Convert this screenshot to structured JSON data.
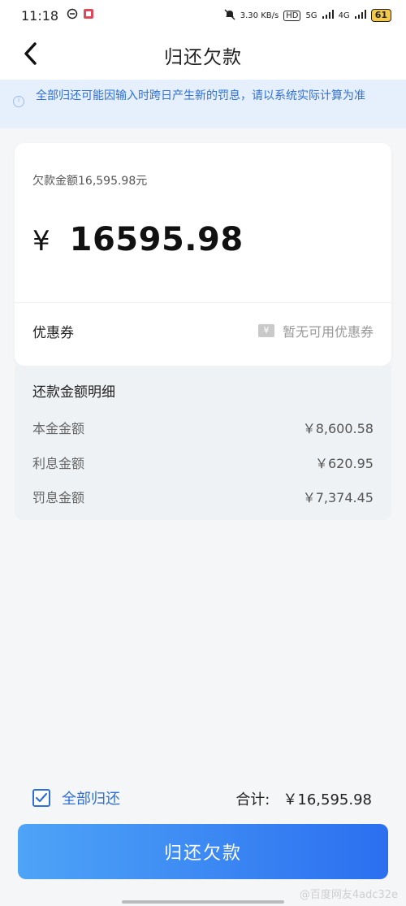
{
  "status_bar": {
    "time": "11:18",
    "net_speed": "3.30 KB/s",
    "hd": "HD",
    "signal_5g": "5G",
    "signal_4g": "4G",
    "battery": "61"
  },
  "header": {
    "title": "归还欠款"
  },
  "notice": {
    "text": "全部归还可能因输入时跨日产生新的罚息，请以系统实际计算为准"
  },
  "card": {
    "debt_label": "欠款金额16,595.98元",
    "currency_symbol": "¥",
    "amount": "16595.98",
    "coupon_label": "优惠券",
    "coupon_value": "暂无可用优惠券"
  },
  "detail": {
    "title": "还款金额明细",
    "rows": [
      {
        "label": "本金金额",
        "value": "￥8,600.58"
      },
      {
        "label": "利息金额",
        "value": "￥620.95"
      },
      {
        "label": "罚息金额",
        "value": "￥7,374.45"
      }
    ]
  },
  "footer": {
    "check_label": "全部归还",
    "total_label": "合计:",
    "total_value": "￥16,595.98",
    "button_label": "归还欠款"
  },
  "watermark": "@百度网友4adc32e",
  "colors": {
    "accent": "#2f6fd8",
    "notice_bg": "#e6f0fc",
    "button_gradient_start": "#4ea4f7",
    "button_gradient_end": "#2b6ff0"
  }
}
